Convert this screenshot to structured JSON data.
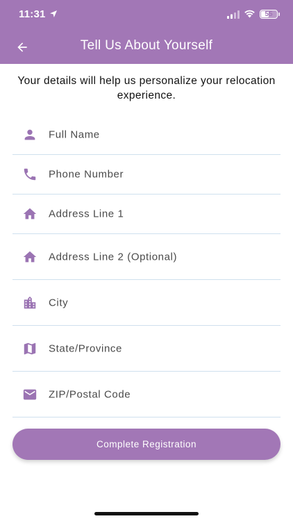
{
  "status_bar": {
    "time": "11:31",
    "battery": "55",
    "battery_level_percent": 55
  },
  "header": {
    "title": "Tell Us About Yourself",
    "background_color": "#a277b6"
  },
  "subtitle": "Your details will help us personalize your relocation experience.",
  "form": {
    "fields": [
      {
        "icon": "person-icon",
        "placeholder": "Full Name",
        "value": ""
      },
      {
        "icon": "phone-icon",
        "placeholder": "Phone Number",
        "value": ""
      },
      {
        "icon": "home-icon",
        "placeholder": "Address Line 1",
        "value": ""
      },
      {
        "icon": "home-icon",
        "placeholder": "Address Line 2 (Optional)",
        "value": ""
      },
      {
        "icon": "city-icon",
        "placeholder": "City",
        "value": ""
      },
      {
        "icon": "map-icon",
        "placeholder": "State/Province",
        "value": ""
      },
      {
        "icon": "mail-icon",
        "placeholder": "ZIP/Postal Code",
        "value": ""
      }
    ],
    "submit_label": "Complete Registration",
    "accent_color": "#9b74b3"
  }
}
